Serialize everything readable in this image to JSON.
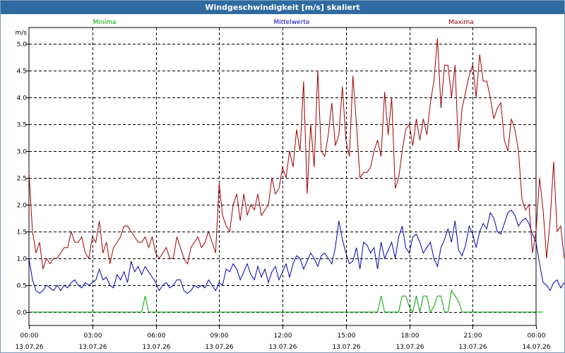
{
  "window": {
    "title": "Windgeschwindigkeit [m/s] skaliert"
  },
  "chart_data": {
    "type": "line",
    "title": "Windgeschwindigkeit [m/s] skaliert",
    "ylabel": "m/s",
    "xlabel": "",
    "ylim": [
      -0.25,
      5.3
    ],
    "xlim_hours": [
      0,
      24
    ],
    "grid": true,
    "legend_placement": "top",
    "y_ticks": [
      "0.0",
      "0.5",
      "1.0",
      "1.5",
      "2.0",
      "2.5",
      "3.0",
      "3.5",
      "4.0",
      "4.5",
      "5.0"
    ],
    "x_ticks": [
      {
        "time": "00:00",
        "date": "13.07.26"
      },
      {
        "time": "03:00",
        "date": "13.07.26"
      },
      {
        "time": "06:00",
        "date": "13.07.26"
      },
      {
        "time": "09:00",
        "date": "13.07.26"
      },
      {
        "time": "12:00",
        "date": "13.07.26"
      },
      {
        "time": "15:00",
        "date": "13.07.26"
      },
      {
        "time": "18:00",
        "date": "13.07.26"
      },
      {
        "time": "21:00",
        "date": "13.07.26"
      },
      {
        "time": "00:00",
        "date": "14.07.26"
      }
    ],
    "sample_interval_minutes": 10,
    "series": [
      {
        "name": "Minima",
        "color": "#00a000",
        "values": [
          0,
          0,
          0,
          0,
          0,
          0,
          0,
          0,
          0,
          0,
          0,
          0,
          0,
          0,
          0,
          0,
          0,
          0,
          0,
          0,
          0,
          0,
          0,
          0,
          0,
          0,
          0,
          0,
          0,
          0,
          0,
          0,
          0,
          0.3,
          0,
          0,
          0,
          0,
          0,
          0,
          0,
          0,
          0,
          0,
          0,
          0,
          0,
          0,
          0,
          0,
          0,
          0,
          0,
          0,
          0,
          0,
          0,
          0,
          0,
          0,
          0,
          0,
          0,
          0,
          0,
          0,
          0,
          0,
          0,
          0,
          0,
          0,
          0,
          0,
          0,
          0,
          0,
          0,
          0,
          0,
          0,
          0,
          0,
          0,
          0,
          0,
          0,
          0,
          0,
          0,
          0,
          0,
          0,
          0,
          0,
          0,
          0,
          0,
          0,
          0,
          0.3,
          0,
          0,
          0,
          0,
          0,
          0.3,
          0.3,
          0.1,
          0,
          0.3,
          0,
          0.3,
          0.3,
          0,
          0.1,
          0.3,
          0.3,
          0,
          0,
          0.4,
          0.3,
          0.2,
          0,
          0,
          0,
          0,
          0,
          0,
          0,
          0,
          0,
          0,
          0,
          0,
          0,
          0,
          0,
          0,
          0,
          0,
          0,
          0,
          0,
          0,
          0,
          0
        ]
      },
      {
        "name": "Mittelwerte",
        "color": "#0000b0",
        "values": [
          1.0,
          0.6,
          0.4,
          0.35,
          0.4,
          0.5,
          0.45,
          0.4,
          0.5,
          0.4,
          0.5,
          0.45,
          0.55,
          0.6,
          0.5,
          0.45,
          0.55,
          0.5,
          0.55,
          0.6,
          0.8,
          0.6,
          0.65,
          0.5,
          0.45,
          0.7,
          0.6,
          0.75,
          0.55,
          0.95,
          0.75,
          0.85,
          0.7,
          0.85,
          0.75,
          0.65,
          0.55,
          0.4,
          0.5,
          0.55,
          0.45,
          0.5,
          0.6,
          0.6,
          0.4,
          0.35,
          0.4,
          0.5,
          0.45,
          0.5,
          0.45,
          0.6,
          0.5,
          0.4,
          0.55,
          0.5,
          0.8,
          0.75,
          0.9,
          0.8,
          0.6,
          0.75,
          0.9,
          0.7,
          0.6,
          0.85,
          0.65,
          0.8,
          0.55,
          0.75,
          0.85,
          0.6,
          0.75,
          0.9,
          0.65,
          0.9,
          1.05,
          1.0,
          0.8,
          0.95,
          1.1,
          1.0,
          0.85,
          1.05,
          1.1,
          1.0,
          0.9,
          1.2,
          1.7,
          1.35,
          1.1,
          0.9,
          0.95,
          1.2,
          0.8,
          1.3,
          1.25,
          1.1,
          1.2,
          0.8,
          1.3,
          1.0,
          1.15,
          1.3,
          1.0,
          1.4,
          1.6,
          1.2,
          1.1,
          1.4,
          1.45,
          1.3,
          1.1,
          1.2,
          1.3,
          1.0,
          0.85,
          1.2,
          1.35,
          1.55,
          1.3,
          1.7,
          1.15,
          1.05,
          1.25,
          1.6,
          1.45,
          1.2,
          1.5,
          1.65,
          1.55,
          1.85,
          1.75,
          1.5,
          1.45,
          1.65,
          1.85,
          1.9,
          1.8,
          1.6,
          1.7,
          1.75,
          1.65,
          1.45,
          1.3,
          0.9,
          0.55,
          0.5,
          0.4,
          0.55,
          0.6,
          0.45,
          0.55,
          0.5,
          0.85,
          0.45,
          0.35,
          0.5,
          0.55,
          0.5,
          0.45,
          0.3,
          0.35,
          0.45,
          0.55,
          0.5
        ]
      },
      {
        "name": "Maxima",
        "color": "#a00000",
        "values": [
          2.6,
          1.5,
          1.1,
          1.3,
          0.8,
          1.0,
          0.9,
          1.0,
          1.0,
          1.1,
          1.2,
          1.2,
          1.5,
          1.3,
          1.3,
          1.4,
          1.1,
          1.0,
          1.4,
          1.3,
          1.7,
          1.1,
          1.3,
          0.9,
          1.2,
          1.3,
          1.4,
          1.6,
          1.6,
          1.5,
          1.4,
          1.3,
          1.3,
          1.4,
          1.2,
          1.4,
          1.1,
          1.0,
          1.1,
          1.2,
          1.0,
          1.0,
          1.4,
          1.2,
          1.0,
          0.9,
          1.2,
          1.3,
          1.4,
          1.2,
          1.3,
          1.5,
          1.3,
          1.1,
          2.4,
          1.8,
          1.6,
          1.5,
          2.0,
          2.2,
          1.7,
          2.2,
          1.8,
          2.0,
          1.9,
          2.2,
          1.8,
          1.9,
          2.0,
          2.5,
          2.2,
          2.3,
          2.7,
          2.5,
          3.0,
          2.7,
          3.4,
          3.0,
          4.3,
          2.2,
          3.5,
          2.7,
          4.5,
          3.0,
          2.9,
          3.3,
          3.9,
          3.1,
          3.3,
          4.2,
          3.2,
          2.9,
          4.4,
          3.5,
          2.5,
          2.6,
          2.6,
          2.7,
          3.0,
          3.2,
          2.9,
          4.1,
          3.3,
          4.0,
          2.3,
          2.5,
          3.0,
          3.4,
          3.5,
          3.1,
          3.6,
          3.2,
          3.6,
          3.3,
          3.9,
          4.3,
          5.1,
          3.8,
          4.6,
          4.6,
          4.0,
          4.6,
          3.0,
          3.8,
          4.1,
          4.4,
          4.6,
          4.0,
          4.8,
          4.3,
          4.3,
          4.0,
          3.6,
          3.8,
          3.9,
          3.2,
          3.0,
          3.6,
          3.4,
          3.0,
          2.1,
          1.9,
          2.0,
          1.1,
          1.5,
          2.5,
          1.9,
          1.0,
          1.7,
          2.8,
          1.5,
          1.6,
          1.0,
          0.9,
          1.0,
          0.8,
          0.9,
          1.0,
          0.9,
          1.0,
          0.9,
          1.0
        ]
      }
    ]
  }
}
